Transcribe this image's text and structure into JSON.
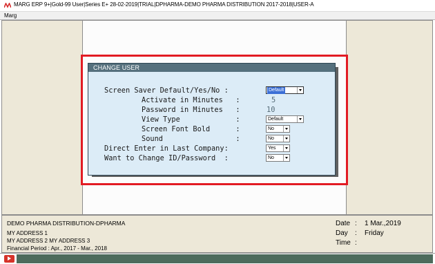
{
  "window": {
    "title": "MARG ERP 9+|Gold-99 User|Series E+ 28-02-2019|TRIAL|DPHARMA-DEMO PHARMA DISTRIBUTION 2017-2018|USER-A"
  },
  "menu": {
    "items": [
      "Marg"
    ]
  },
  "dialog": {
    "title": "CHANGE USER",
    "fields": {
      "screen_saver": {
        "label": "Screen Saver Default/Yes/No :",
        "value": "Default"
      },
      "activate_minutes": {
        "label": "Activate in Minutes   :",
        "value": "5"
      },
      "password_minutes": {
        "label": "Password in Minutes   :",
        "value": "10"
      },
      "view_type": {
        "label": "View Type             :",
        "value": "Default"
      },
      "screen_font_bold": {
        "label": "Screen Font Bold      :",
        "value": "No"
      },
      "sound": {
        "label": "Sound                 :",
        "value": "No"
      },
      "direct_enter": {
        "label": "Direct Enter in Last Company:",
        "value": "Yes"
      },
      "change_id_password": {
        "label": "Want to Change ID/Password  :",
        "value": "No"
      }
    }
  },
  "footer": {
    "company": "DEMO PHARMA DISTRIBUTION-DPHARMA",
    "address1": "MY ADDRESS 1",
    "address2": "MY ADDRESS 2 MY ADDRESS 3",
    "financial_period": "Financial Period : Apr., 2017 - Mar., 2018",
    "date_label": "Date",
    "date_value": "1 Mar.,2019",
    "day_label": "Day",
    "day_value": "Friday",
    "time_label": "Time",
    "colon": ":"
  },
  "colors": {
    "highlight": "#e21b23",
    "dialog_bg": "#dcecf7",
    "dialog_header": "#55707d",
    "panel_bg": "#ede8d8",
    "selection": "#3b6fd6"
  },
  "icons": [
    "marg-app-icon",
    "play-icon"
  ]
}
